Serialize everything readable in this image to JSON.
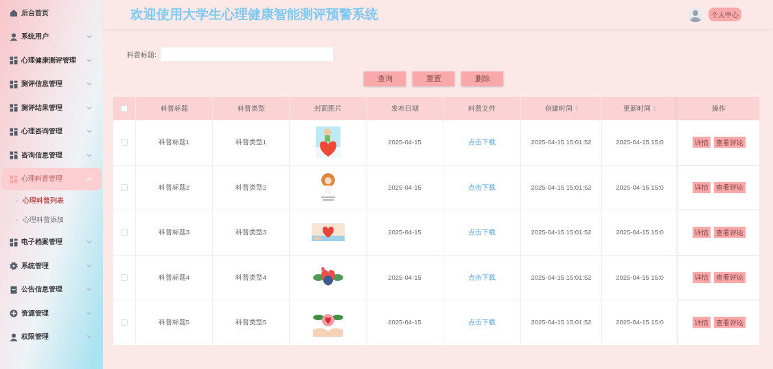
{
  "header": {
    "title": "欢迎使用大学生心理健康智能测评预警系统",
    "user_button": "个人中心"
  },
  "sidebar": {
    "items": [
      {
        "label": "后台首页",
        "selected": false
      },
      {
        "label": "系统用户",
        "selected": false,
        "expanded": false
      },
      {
        "label": "心理健康测评管理",
        "selected": false,
        "expanded": false
      },
      {
        "label": "测评信息管理",
        "selected": false,
        "expanded": false
      },
      {
        "label": "测评结果管理",
        "selected": false,
        "expanded": false
      },
      {
        "label": "心理咨询管理",
        "selected": false,
        "expanded": false
      },
      {
        "label": "咨询信息管理",
        "selected": false,
        "expanded": false
      },
      {
        "label": "心理科普管理",
        "selected": true,
        "expanded": true,
        "children": [
          {
            "label": "心理科普列表",
            "selected": true
          },
          {
            "label": "心理科普添加",
            "selected": false
          }
        ]
      },
      {
        "label": "电子档案管理",
        "selected": false,
        "expanded": false
      },
      {
        "label": "系统管理",
        "selected": false,
        "expanded": false
      },
      {
        "label": "公告信息管理",
        "selected": false,
        "expanded": false
      },
      {
        "label": "资源管理",
        "selected": false,
        "expanded": false
      },
      {
        "label": "权限管理",
        "selected": false,
        "expanded": false
      }
    ]
  },
  "search": {
    "label": "科普标题:",
    "buttons": [
      "查询",
      "重置",
      "删除"
    ]
  },
  "table": {
    "columns": [
      {
        "label": "科普标题",
        "sortable": false
      },
      {
        "label": "科普类型",
        "sortable": false
      },
      {
        "label": "封面图片",
        "sortable": false
      },
      {
        "label": "发布日期",
        "sortable": false
      },
      {
        "label": "科普文件",
        "sortable": false
      },
      {
        "label": "创建时间",
        "sortable": true
      },
      {
        "label": "更新时间",
        "sortable": true
      },
      {
        "label": "操作",
        "sortable": false
      }
    ],
    "all_checked": false,
    "rows": [
      {
        "checked": false,
        "title": "科普标题1",
        "type": "科普类型1",
        "cover": {
          "kind": "picture"
        },
        "date": "2025-04-15",
        "file": "点击下载",
        "created": "2025-04-15 15:01:52",
        "updated": "2025-04-15 15:0",
        "actions": [
          "详情",
          "查看评论"
        ]
      },
      {
        "checked": false,
        "title": "科普标题2",
        "type": "科普类型2",
        "cover": {
          "kind": "picture"
        },
        "date": "2025-04-15",
        "file": "点击下载",
        "created": "2025-04-15 15:01:52",
        "updated": "2025-04-15 15:0",
        "actions": [
          "详情",
          "查看评论"
        ]
      },
      {
        "checked": false,
        "title": "科普标题3",
        "type": "科普类型3",
        "cover": {
          "kind": "picture"
        },
        "date": "2025-04-15",
        "file": "点击下载",
        "created": "2025-04-15 15:01:52",
        "updated": "2025-04-15 15:0",
        "actions": [
          "详情",
          "查看评论"
        ]
      },
      {
        "checked": false,
        "title": "科普标题4",
        "type": "科普类型4",
        "cover": {
          "kind": "picture"
        },
        "date": "2025-04-15",
        "file": "点击下载",
        "created": "2025-04-15 15:01:52",
        "updated": "2025-04-15 15:0",
        "actions": [
          "详情",
          "查看评论"
        ]
      },
      {
        "checked": false,
        "title": "科普标题5",
        "type": "科普类型5",
        "cover": {
          "kind": "picture"
        },
        "date": "2025-04-15",
        "file": "点击下载",
        "created": "2025-04-15 15:01:52",
        "updated": "2025-04-15 15:0",
        "actions": [
          "详情",
          "查看评论"
        ]
      }
    ]
  }
}
